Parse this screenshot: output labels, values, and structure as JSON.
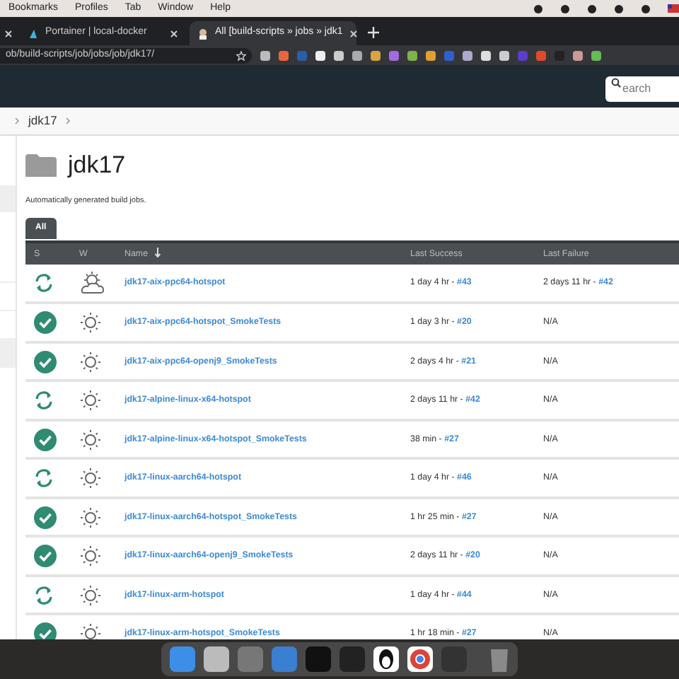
{
  "menu_bar": {
    "items": [
      "Bookmarks",
      "Profiles",
      "Tab",
      "Window",
      "Help"
    ]
  },
  "tabs": [
    {
      "selected": false
    },
    {
      "label": "Portainer | local-docker",
      "selected": false
    },
    {
      "label": "All [build-scripts » jobs » jdk1",
      "selected": true
    }
  ],
  "address_bar": {
    "url": "ob/build-scripts/job/jobs/job/jdk17/"
  },
  "header": {
    "search": {
      "placeholder": "earch"
    }
  },
  "breadcrumb": [
    "jdk17"
  ],
  "folder": {
    "title": "jdk17",
    "description": "Automatically generated build jobs."
  },
  "view_tabs": [
    {
      "label": "All",
      "selected": true
    }
  ],
  "table": {
    "columns": [
      "S",
      "W",
      "Name",
      "Last Success",
      "Last Failure"
    ],
    "rows": [
      {
        "status": {
          "kind": "running"
        },
        "weather": {
          "kind": "cloudy"
        },
        "name": "jdk17-aix-ppc64-hotspot",
        "last_success": "1 day 4 hr - ",
        "success_build": "#43",
        "last_failure": "2 days 11 hr - ",
        "failure_build": "#42"
      },
      {
        "status": {
          "kind": "success"
        },
        "weather": {
          "kind": "sunny"
        },
        "name": "jdk17-aix-ppc64-hotspot_SmokeTests",
        "last_success": "1 day 3 hr - ",
        "success_build": "#20",
        "last_failure": "N/A"
      },
      {
        "status": {
          "kind": "success"
        },
        "weather": {
          "kind": "sunny"
        },
        "name": "jdk17-aix-ppc64-openj9_SmokeTests",
        "last_success": "2 days 4 hr - ",
        "success_build": "#21",
        "last_failure": "N/A"
      },
      {
        "status": {
          "kind": "running"
        },
        "weather": {
          "kind": "sunny"
        },
        "name": "jdk17-alpine-linux-x64-hotspot",
        "last_success": "2 days 11 hr - ",
        "success_build": "#42",
        "last_failure": "N/A"
      },
      {
        "status": {
          "kind": "success"
        },
        "weather": {
          "kind": "sunny"
        },
        "name": "jdk17-alpine-linux-x64-hotspot_SmokeTests",
        "last_success": "38 min - ",
        "success_build": "#27",
        "last_failure": "N/A"
      },
      {
        "status": {
          "kind": "running"
        },
        "weather": {
          "kind": "sunny"
        },
        "name": "jdk17-linux-aarch64-hotspot",
        "last_success": "1 day 4 hr - ",
        "success_build": "#46",
        "last_failure": "N/A"
      },
      {
        "status": {
          "kind": "success"
        },
        "weather": {
          "kind": "sunny"
        },
        "name": "jdk17-linux-aarch64-hotspot_SmokeTests",
        "last_success": "1 hr 25 min - ",
        "success_build": "#27",
        "last_failure": "N/A"
      },
      {
        "status": {
          "kind": "success"
        },
        "weather": {
          "kind": "sunny"
        },
        "name": "jdk17-linux-aarch64-openj9_SmokeTests",
        "last_success": "2 days 11 hr - ",
        "success_build": "#20",
        "last_failure": "N/A"
      },
      {
        "status": {
          "kind": "running"
        },
        "weather": {
          "kind": "sunny"
        },
        "name": "jdk17-linux-arm-hotspot",
        "last_success": "1 day 4 hr - ",
        "success_build": "#44",
        "last_failure": "N/A"
      },
      {
        "status": {
          "kind": "success"
        },
        "weather": {
          "kind": "sunny"
        },
        "name": "jdk17-linux-arm-hotspot_SmokeTests",
        "last_success": "1 hr 18 min - ",
        "success_build": "#27",
        "last_failure": "N/A"
      }
    ]
  }
}
